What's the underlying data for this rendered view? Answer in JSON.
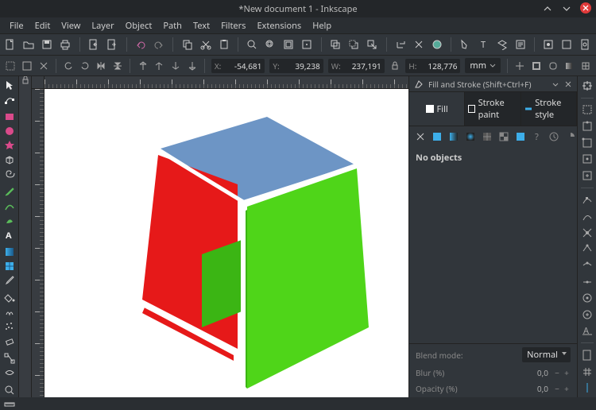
{
  "window": {
    "title": "*New document 1 - Inkscape"
  },
  "menu": [
    "File",
    "Edit",
    "View",
    "Layer",
    "Object",
    "Path",
    "Text",
    "Filters",
    "Extensions",
    "Help"
  ],
  "controls": {
    "x": {
      "label": "X:",
      "value": "-54,681"
    },
    "y": {
      "label": "Y:",
      "value": "39,238"
    },
    "w": {
      "label": "W:",
      "value": "237,191"
    },
    "h": {
      "label": "H:",
      "value": "128,776"
    },
    "unit": "mm"
  },
  "dock": {
    "title": "Fill and Stroke (Shift+Ctrl+F)",
    "tabs": {
      "fill": "Fill",
      "stroke_paint": "Stroke paint",
      "stroke_style": "Stroke style"
    },
    "message": "No objects",
    "blend": {
      "label": "Blend mode:",
      "value": "Normal"
    },
    "blur": {
      "label": "Blur (%)",
      "value": "0,0"
    },
    "opacity": {
      "label": "Opacity (%)",
      "value": "0,0"
    }
  },
  "cube": {
    "top": "#6d95c5",
    "left": "#e61919",
    "front": "#4fd519"
  }
}
